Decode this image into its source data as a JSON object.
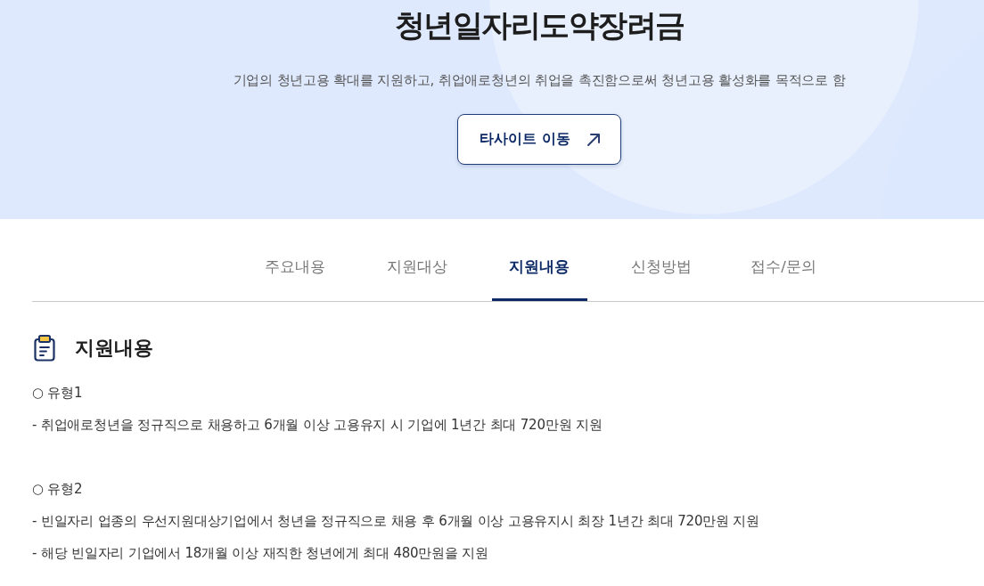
{
  "hero": {
    "title": "청년일자리도약장려금",
    "description": "기업의 청년고용 확대를 지원하고, 취업애로청년의 취업을 촉진함으로써 청년고용 활성화를 목적으로 함",
    "link_button": {
      "label": "타사이트 이동"
    }
  },
  "tabs": [
    {
      "label": "주요내용",
      "selected": false
    },
    {
      "label": "지원대상",
      "selected": false
    },
    {
      "label": "지원내용",
      "selected": true
    },
    {
      "label": "신청방법",
      "selected": false
    },
    {
      "label": "접수/문의",
      "selected": false
    }
  ],
  "section": {
    "title": "지원내용",
    "groups": [
      {
        "heading": "○ 유형1",
        "lines": [
          "- 취업애로청년을 정규직으로 채용하고 6개월 이상 고용유지 시 기업에 1년간 최대 720만원 지원"
        ]
      },
      {
        "heading": "○ 유형2",
        "lines": [
          "- 빈일자리 업종의 우선지원대상기업에서 청년을 정규직으로 채용 후 6개월 이상 고용유지시 최장 1년간 최대 720만원 지원",
          "- 해당 빈일자리 기업에서 18개월 이상 재직한 청년에게 최대 480만원을 지원"
        ]
      }
    ]
  }
}
